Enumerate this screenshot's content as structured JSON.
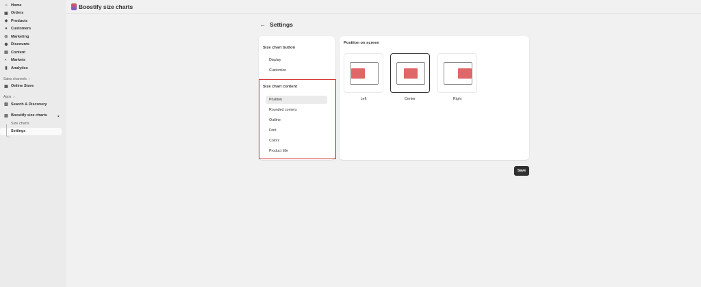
{
  "sidebar": {
    "main_items": [
      {
        "label": "Home",
        "icon": "home-icon"
      },
      {
        "label": "Orders",
        "icon": "orders-icon"
      },
      {
        "label": "Products",
        "icon": "tag-icon"
      },
      {
        "label": "Customers",
        "icon": "person-icon"
      },
      {
        "label": "Marketing",
        "icon": "target-icon"
      },
      {
        "label": "Discounts",
        "icon": "discount-icon"
      },
      {
        "label": "Content",
        "icon": "content-icon"
      },
      {
        "label": "Markets",
        "icon": "globe-icon"
      },
      {
        "label": "Analytics",
        "icon": "bar-chart-icon"
      }
    ],
    "sales_channels_label": "Sales channels",
    "online_store": "Online Store",
    "apps_label": "Apps",
    "search_discovery": "Search & Discovery",
    "app_name": "Boostify size charts",
    "sub_items": [
      "Size charts",
      "Settings"
    ]
  },
  "topbar": {
    "title": "Boostify size charts"
  },
  "page": {
    "title": "Settings"
  },
  "settings_menu": {
    "button_group_title": "Size chart button",
    "button_items": [
      "Display",
      "Customize"
    ],
    "content_group_title": "Size chart content",
    "content_items": [
      "Position",
      "Rounded corners",
      "Outline",
      "Font",
      "Colors",
      "Product title"
    ]
  },
  "position_panel": {
    "title": "Position on screen",
    "options": [
      "Left",
      "Center",
      "Right"
    ],
    "selected": "Center",
    "accent_color": "#e06767"
  },
  "save_label": "Save"
}
